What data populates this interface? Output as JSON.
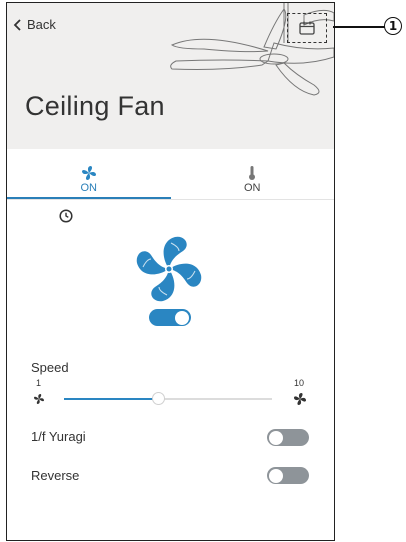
{
  "nav": {
    "back_label": "Back"
  },
  "header": {
    "title": "Ceiling Fan"
  },
  "tabs": [
    {
      "label": "ON",
      "icon": "fan-icon",
      "active": true
    },
    {
      "label": "ON",
      "icon": "thermometer-icon",
      "active": false
    }
  ],
  "power": {
    "on": true
  },
  "speed": {
    "label": "Speed",
    "min": "1",
    "max": "10",
    "value_fraction": 0.45
  },
  "settings": [
    {
      "label": "1/f Yuragi",
      "on": false
    },
    {
      "label": "Reverse",
      "on": false
    }
  ],
  "annotation": {
    "label": "1"
  },
  "colors": {
    "accent": "#2a86c2",
    "header_bg": "#f0efee",
    "toggle_off": "#8e9499"
  }
}
